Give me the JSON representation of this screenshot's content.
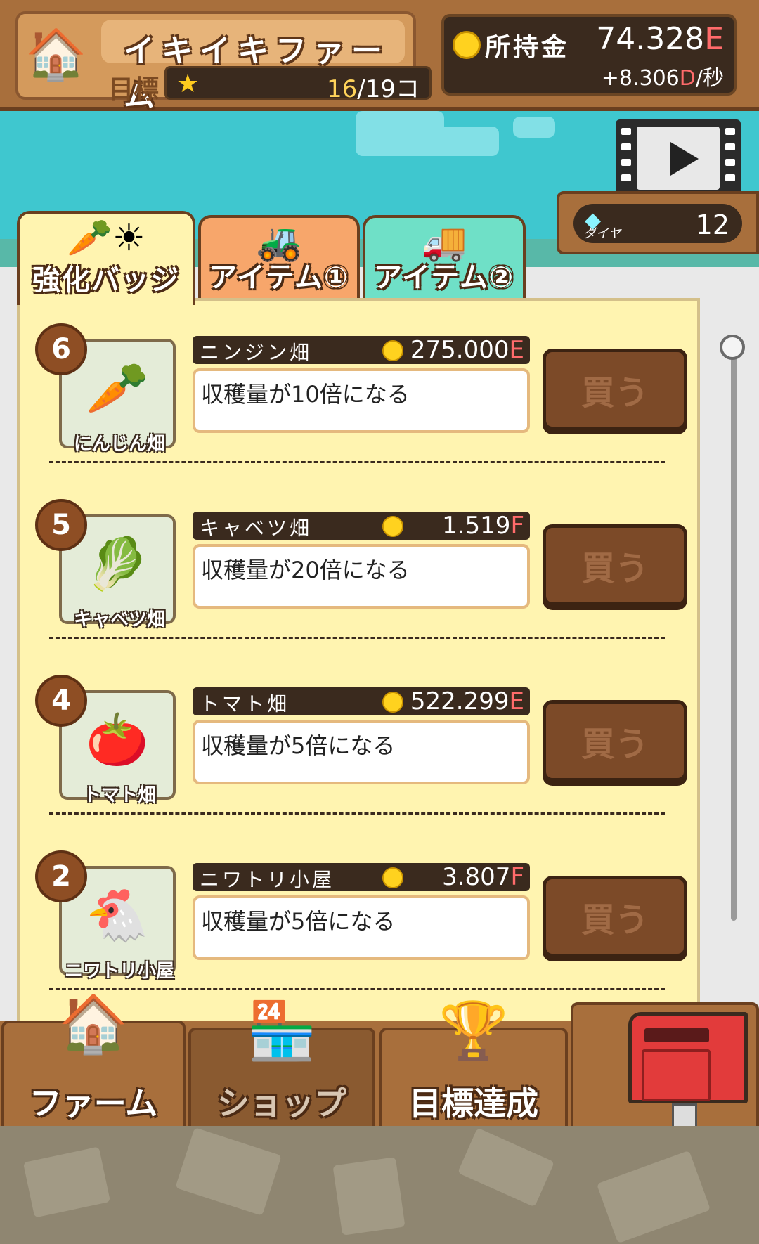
{
  "header": {
    "farm_name": "イキイキファーム",
    "goal_label": "目標",
    "goal_progress": "16",
    "goal_total": "/19コ",
    "money_label": "所持金",
    "money_value": "74.328",
    "money_unit": "E",
    "money_rate_prefix": "+8.306",
    "money_rate_unit": "D",
    "money_rate_suffix": "/秒"
  },
  "diamond": {
    "label": "ダイヤ",
    "value": "12"
  },
  "tabs": [
    {
      "label": "強化バッジ",
      "active": true,
      "icon": "carrot-sun-icon"
    },
    {
      "label": "アイテム①",
      "active": false,
      "icon": "tractor-icon"
    },
    {
      "label": "アイテム②",
      "active": false,
      "icon": "truck-icon"
    }
  ],
  "upgrades": [
    {
      "level": "6",
      "thumb_label": "にんじん畑",
      "name": "ニンジン畑",
      "price": "275.000",
      "price_unit": "E",
      "description": "収穫量が10倍になる",
      "buy_label": "買う",
      "icon": "carrot-field-icon"
    },
    {
      "level": "5",
      "thumb_label": "キャベツ畑",
      "name": "キャベツ畑",
      "price": "1.519",
      "price_unit": "F",
      "description": "収穫量が20倍になる",
      "buy_label": "買う",
      "icon": "cabbage-field-icon"
    },
    {
      "level": "4",
      "thumb_label": "トマト畑",
      "name": "トマト畑",
      "price": "522.299",
      "price_unit": "E",
      "description": "収穫量が5倍になる",
      "buy_label": "買う",
      "icon": "tomato-field-icon"
    },
    {
      "level": "2",
      "thumb_label": "ニワトリ小屋",
      "name": "ニワトリ小屋",
      "price": "3.807",
      "price_unit": "F",
      "description": "収穫量が5倍になる",
      "buy_label": "買う",
      "icon": "chicken-coop-icon"
    }
  ],
  "nav": {
    "farm": "ファーム",
    "shop": "ショップ",
    "goal": "目標達成"
  },
  "colors": {
    "wood": "#a86f3c",
    "panel": "#fff4b0",
    "sky": "#3fc7cf",
    "price_unit": "#ff6b6b"
  }
}
